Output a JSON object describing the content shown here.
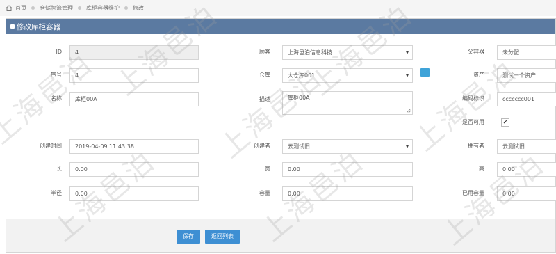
{
  "breadcrumb": {
    "home": "首页",
    "level1": "仓储物流管理",
    "level2": "库柜容器维护",
    "level3": "修改"
  },
  "panel": {
    "title": "修改库柜容器"
  },
  "form": {
    "id": {
      "label": "ID",
      "value": "4"
    },
    "customer": {
      "label": "顾客",
      "value": "上海邑泊信息科技"
    },
    "parent": {
      "label": "父容器",
      "value": "未分配"
    },
    "seq": {
      "label": "序号",
      "value": "4"
    },
    "warehouse": {
      "label": "仓库",
      "value": "大仓库001",
      "pick": "..."
    },
    "asset": {
      "label": "资产",
      "value": "测试一个资产"
    },
    "name": {
      "label": "名称",
      "value": "库柜00A"
    },
    "desc": {
      "label": "描述",
      "value": "库柜00A"
    },
    "code": {
      "label": "编码标识",
      "value": "ccccccc001"
    },
    "available": {
      "label": "是否可用",
      "value": "✔"
    },
    "created_at": {
      "label": "创建时间",
      "value": "2019-04-09 11:43:38"
    },
    "creator": {
      "label": "创建者",
      "value": "云测试旧"
    },
    "owner": {
      "label": "拥有者",
      "value": "云测试旧"
    },
    "length": {
      "label": "长",
      "value": "0.00"
    },
    "width": {
      "label": "宽",
      "value": "0.00"
    },
    "height": {
      "label": "高",
      "value": "0.00"
    },
    "radius": {
      "label": "半径",
      "value": "0.00"
    },
    "capacity": {
      "label": "容量",
      "value": "0.00"
    },
    "used_capacity": {
      "label": "已用容量",
      "value": "0.00"
    }
  },
  "buttons": {
    "save": "保存",
    "back": "返回列表"
  },
  "watermark": "上海邑泊",
  "colors": {
    "header": "#5b7aa1",
    "button": "#3e8fd3",
    "pick_button": "#3fa3d8"
  }
}
